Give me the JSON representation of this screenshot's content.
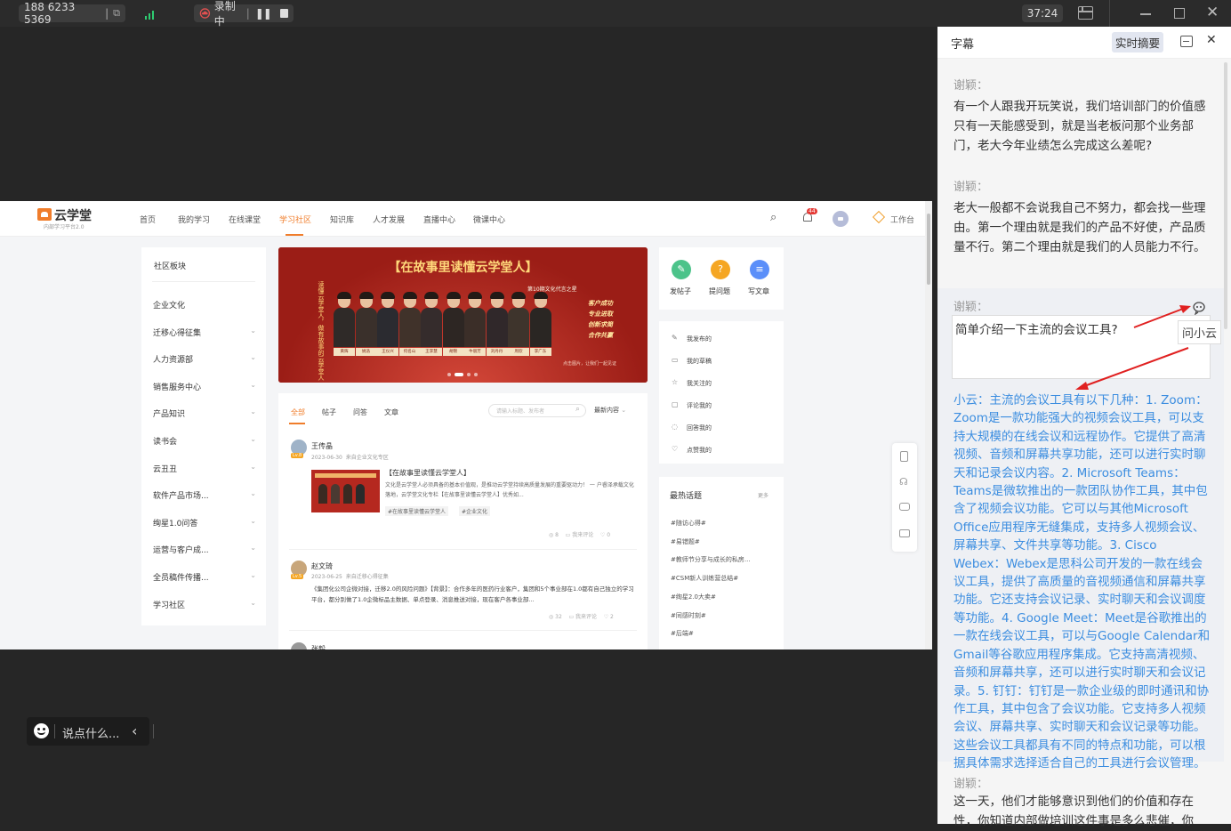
{
  "topbar": {
    "meeting_id": "188 6233 5369",
    "recording_label": "录制中",
    "timer": "37:24"
  },
  "site": {
    "logo_title": "云学堂",
    "logo_subtitle": "内部学习平台2.0",
    "nav": [
      "首页",
      "我的学习",
      "在线课堂",
      "学习社区",
      "知识库",
      "人才发展",
      "直播中心",
      "微课中心"
    ],
    "active_nav": "学习社区",
    "notif_count": "44",
    "workbench_label": "工作台",
    "sidebar_title": "社区板块",
    "sidebar_items": [
      "企业文化",
      "迁移心得征集",
      "人力资源部",
      "销售服务中心",
      "产品知识",
      "读书会",
      "云丑丑",
      "软件产品市场...",
      "绚星1.0问答",
      "运营与客户成...",
      "全员稿件传播...",
      "学习社区"
    ],
    "banner": {
      "title": "【在故事里读懂云学堂人】",
      "vertical_left": "读懂云学堂人，做有故事的云学堂人",
      "badge": "第10期文化代言之星",
      "values": [
        "客户成功",
        "专业进取",
        "创新求简",
        "合作共赢"
      ],
      "footer": "点击图片，让我们一起见证",
      "names": [
        "黄辉",
        "姚浩",
        "王仪兴",
        "何名山",
        "王李慧",
        "胡锦",
        "牛丽芳",
        "刘丹丹",
        "周欣",
        "李广东"
      ]
    },
    "actions": [
      {
        "label": "发帖子",
        "color": "#4cc38a",
        "icon": "pencil-icon",
        "glyph": "✎"
      },
      {
        "label": "提问题",
        "color": "#f5a623",
        "icon": "question-icon",
        "glyph": "?"
      },
      {
        "label": "写文章",
        "color": "#5b8ff9",
        "icon": "document-icon",
        "glyph": "≡"
      }
    ],
    "user_center": [
      {
        "label": "我发布的",
        "glyph": "✎"
      },
      {
        "label": "我的草稿",
        "glyph": "▭"
      },
      {
        "label": "我关注的",
        "glyph": "☆"
      },
      {
        "label": "评论我的",
        "glyph": "▢"
      },
      {
        "label": "回答我的",
        "glyph": "◌"
      },
      {
        "label": "点赞我的",
        "glyph": "♡"
      }
    ],
    "hot_topics_title": "最热话题",
    "hot_more": "更多",
    "hot_topics": [
      "#随访心得#",
      "#易错题#",
      "#教师节分享与成长的私房...",
      "#CSM新人训练营总结#",
      "#绚星2.0大卖#",
      "#同感时刻#",
      "#后端#"
    ],
    "tabs": [
      "全部",
      "帖子",
      "问答",
      "文章"
    ],
    "active_tab": "全部",
    "search_placeholder": "请输入标题、发布者",
    "sort_label": "最新内容",
    "posts": [
      {
        "author": "王传晶",
        "level": "Lv.8",
        "date": "2023-06-30",
        "source": "来自企业文化专区",
        "title": "【在故事里读懂云学堂人】",
        "body": "文化是云学堂人必须具备的基本价值观，是推动云学堂持续高质量发展的重要驱动力！ 一 户睿泽承载文化落地，云学堂文化专栏【在故事里读懂云学堂人】优秀如...",
        "tags": [
          "#在故事里读懂云学堂人",
          "#企业文化"
        ],
        "views": "8",
        "comment_label": "我来评论",
        "likes": "0"
      },
      {
        "author": "赵文琦",
        "level": "Lv.5",
        "date": "2023-06-25",
        "source": "来自迁移心得征集",
        "body": "《集团化公司企微对接，迁移2.0的风险问题》【背景】：合作多年的医药行业客户，集团和5个事业部在1.0都有自己独立的学习平台，都分别做了1.0企微标品主数据、单点登录、消息推送对接，现在客户各事业部...",
        "views": "32",
        "comment_label": "我来评论",
        "likes": "2"
      },
      {
        "author": "张毅"
      }
    ]
  },
  "chat_bar": {
    "placeholder": "说点什么..."
  },
  "panel": {
    "title": "字幕",
    "summary_button": "实时摘要",
    "blocks": [
      {
        "speaker": "谢颖：",
        "text": "有一个人跟我开玩笑说，我们培训部门的价值感只有一天能感受到，就是当老板问那个业务部门，老大今年业绩怎么完成这么差呢?"
      },
      {
        "speaker": "谢颖：",
        "text": "老大一般都不会说我自己不努力，都会找一些理由。第一个理由就是我们的产品不好使，产品质量不行。第二个理由就是我们的人员能力不行。"
      }
    ],
    "question_speaker": "谢颖：",
    "question_input": "简单介绍一下主流的会议工具?",
    "tooltip": "问小云",
    "ai_answer": "小云：主流的会议工具有以下几种：1. Zoom：Zoom是一款功能强大的视频会议工具，可以支持大规模的在线会议和远程协作。它提供了高清视频、音频和屏幕共享功能，还可以进行实时聊天和记录会议内容。2. Microsoft Teams：Teams是微软推出的一款团队协作工具，其中包含了视频会议功能。它可以与其他Microsoft Office应用程序无缝集成，支持多人视频会议、屏幕共享、文件共享等功能。3. Cisco Webex：Webex是思科公司开发的一款在线会议工具，提供了高质量的音视频通信和屏幕共享功能。它还支持会议记录、实时聊天和会议调度等功能。4. Google Meet：Meet是谷歌推出的一款在线会议工具，可以与Google Calendar和Gmail等谷歌应用程序集成。它支持高清视频、音频和屏幕共享，还可以进行实时聊天和会议记录。5. 钉钉：钉钉是一款企业级的即时通讯和协作工具，其中包含了会议功能。它支持多人视频会议、屏幕共享、实时聊天和会议记录等功能。这些会议工具都具有不同的特点和功能，可以根据具体需求选择适合自己的工具进行会议管理。",
    "last_speaker": "谢颖：",
    "last_text": "这一天，他们才能够意识到他们的价值和存在性，你知道内部做培训这件事是多么悲催，你"
  },
  "colors": {
    "accent": "#f07d2b",
    "ai_text": "#3b8de0",
    "arrow": "#e02020",
    "banner_bg": "#b5281f"
  }
}
